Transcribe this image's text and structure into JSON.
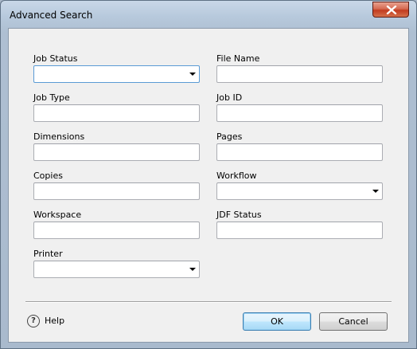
{
  "window": {
    "title": "Advanced Search"
  },
  "fields": {
    "job_status": {
      "label": "Job Status",
      "value": ""
    },
    "file_name": {
      "label": "File Name",
      "value": ""
    },
    "job_type": {
      "label": "Job Type",
      "value": ""
    },
    "job_id": {
      "label": "Job ID",
      "value": ""
    },
    "dimensions": {
      "label": "Dimensions",
      "value": ""
    },
    "pages": {
      "label": "Pages",
      "value": ""
    },
    "copies": {
      "label": "Copies",
      "value": ""
    },
    "workflow": {
      "label": "Workflow",
      "value": ""
    },
    "workspace": {
      "label": "Workspace",
      "value": ""
    },
    "jdf_status": {
      "label": "JDF Status",
      "value": ""
    },
    "printer": {
      "label": "Printer",
      "value": ""
    }
  },
  "footer": {
    "help_icon_glyph": "?",
    "help_label": "Help",
    "ok_label": "OK",
    "cancel_label": "Cancel"
  },
  "icons": {
    "close": "close-x-icon",
    "dropdown": "chevron-down-icon",
    "help": "help-circle-icon"
  }
}
